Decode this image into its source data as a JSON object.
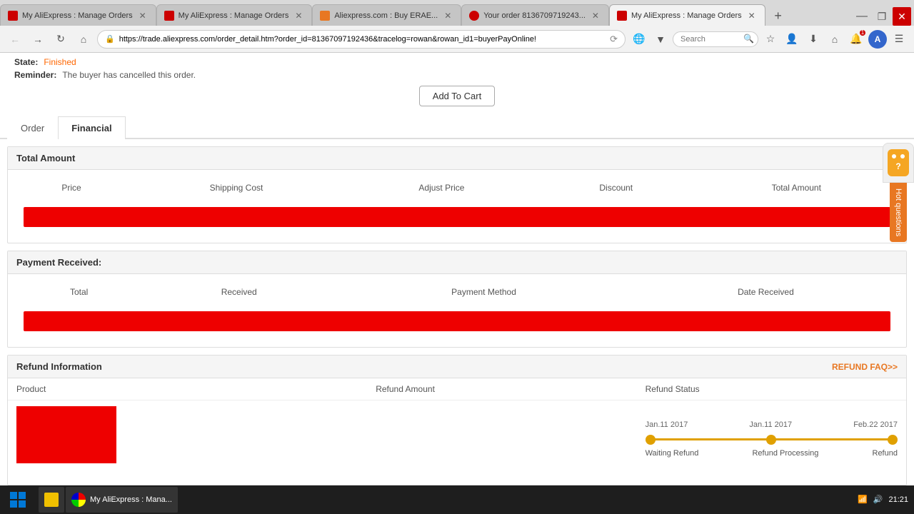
{
  "browser": {
    "tabs": [
      {
        "id": "tab1",
        "title": "My AliExpress : Manage Orders",
        "favicon": "ali",
        "active": false,
        "closable": true
      },
      {
        "id": "tab2",
        "title": "My AliExpress : Manage Orders",
        "favicon": "ali",
        "active": false,
        "closable": true
      },
      {
        "id": "tab3",
        "title": "Aliexpress.com : Buy ERAE...",
        "favicon": "ali-orange",
        "active": false,
        "closable": true
      },
      {
        "id": "tab4",
        "title": "Your order 8136709719243...",
        "favicon": "gmail",
        "active": false,
        "closable": true
      },
      {
        "id": "tab5",
        "title": "My AliExpress : Manage Orders",
        "favicon": "ali",
        "active": true,
        "closable": true
      }
    ],
    "address": "https://trade.aliexpress.com/order_detail.htm?order_id=81367097192436&tracelog=rowan&rowan_id1=buyerPayOnline!",
    "new_tab_label": "+",
    "search_placeholder": "Search"
  },
  "page": {
    "state_label": "State:",
    "state_value": "Finished",
    "reminder_label": "Reminder:",
    "reminder_text": "The buyer has cancelled this order.",
    "add_to_cart_label": "Add To Cart",
    "tabs": [
      {
        "id": "order",
        "label": "Order"
      },
      {
        "id": "financial",
        "label": "Financial"
      }
    ],
    "active_tab": "financial"
  },
  "total_amount": {
    "title": "Total Amount",
    "columns": [
      "Price",
      "Shipping Cost",
      "Adjust Price",
      "Discount",
      "Total Amount"
    ]
  },
  "payment_received": {
    "title": "Payment Received:",
    "columns": [
      "Total",
      "Received",
      "Payment Method",
      "Date Received"
    ]
  },
  "refund_info": {
    "title": "Refund Information",
    "faq_label": "REFUND FAQ>>",
    "columns": [
      "Product",
      "Refund Amount",
      "Refund Status"
    ],
    "timeline": [
      {
        "date": "Jan.11 2017",
        "label": "Waiting Refund"
      },
      {
        "date": "Jan.11 2017",
        "label": "Refund Processing"
      },
      {
        "date": "Feb.22 2017",
        "label": "Refund"
      }
    ]
  },
  "hot_questions": {
    "label": "Hot questions"
  },
  "taskbar": {
    "time": "21:21",
    "date": "",
    "app_label": "My AliExpress : Mana..."
  }
}
